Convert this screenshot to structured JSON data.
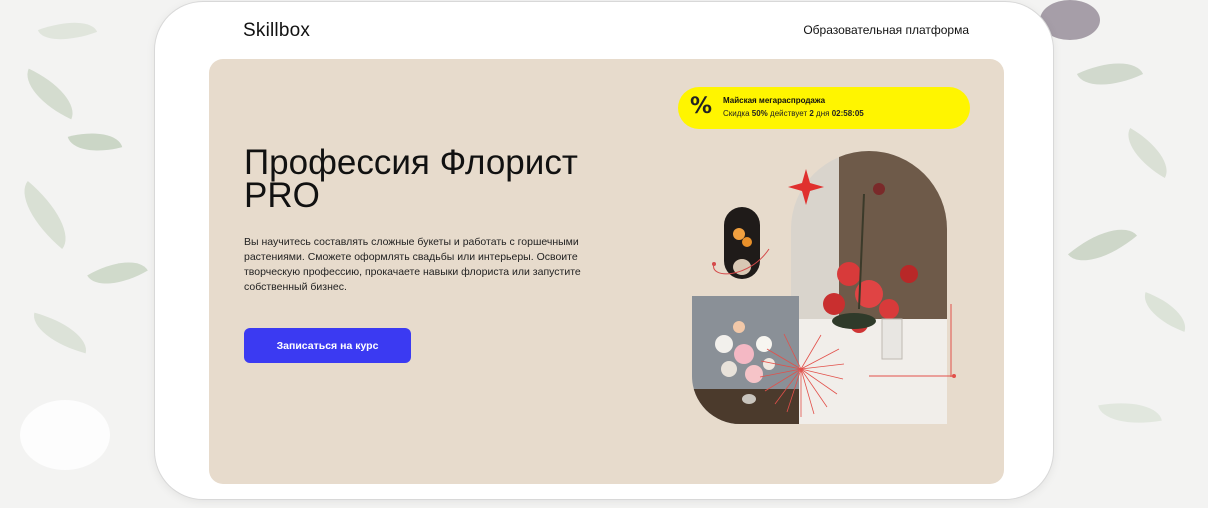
{
  "header": {
    "logo": "Skillbox",
    "platform_label": "Образовательная платформа"
  },
  "promo": {
    "icon": "percent-icon",
    "title": "Майская мегараспродажа",
    "discount_prefix": "Скидка",
    "discount_value": "50%",
    "valid_text": "действует",
    "days_value": "2",
    "days_label": "дня",
    "timer": "02:58:05"
  },
  "hero": {
    "title_line1": "Профессия Флорист",
    "title_line2": "PRO",
    "description": "Вы научитесь составлять сложные букеты и работать с горшечными растениями. Сможете оформлять свадьбы или интерьеры. Освоите творческую профессию, прокачаете навыки флориста или запустите собственный бизнес.",
    "cta_label": "Записаться на курс"
  },
  "colors": {
    "hero_bg": "#e7dbcc",
    "cta": "#3b3af2",
    "promo": "#fff500",
    "accent_red": "#e0302e"
  }
}
